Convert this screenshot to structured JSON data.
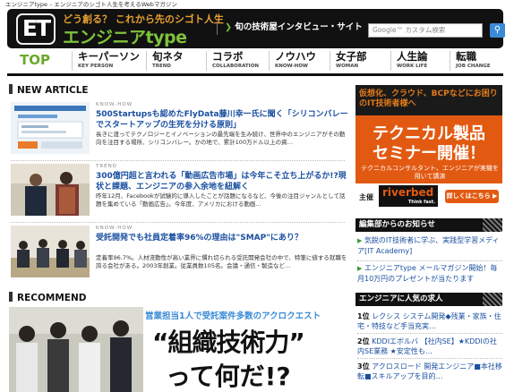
{
  "topline": "エンジニアtype – エンジニアのシゴト人生を考えるWebマガジン",
  "header": {
    "logo_mark": "ET",
    "slogan": "どう創る？ これから先のシゴト人生",
    "site_name": "エンジニアtype",
    "banner_text": "旬の技術屋インタビュー・サイト",
    "search_placeholder": "Google™ カスタム検索",
    "search_icon": "search-icon"
  },
  "nav": {
    "top_label": "TOP",
    "items": [
      {
        "jp": "キーパーソン",
        "en": "KEY PERSON"
      },
      {
        "jp": "旬ネタ",
        "en": "TREND"
      },
      {
        "jp": "コラボ",
        "en": "COLLABORATION"
      },
      {
        "jp": "ノウハウ",
        "en": "KNOW-HOW"
      },
      {
        "jp": "女子部",
        "en": "WOMAN"
      },
      {
        "jp": "人生論",
        "en": "WORK LIFE"
      },
      {
        "jp": "転職",
        "en": "JOB CHANGE"
      }
    ]
  },
  "new_article": {
    "heading": "NEW ARTICLE",
    "articles": [
      {
        "category": "KNOW-HOW",
        "title": "500Startupsも認めたFlyData藤川幸一氏に聞く「シリコンバレーでスタートアップの生死を分ける原則」",
        "summary": "長きに渡ってテクノロジーとイノベーションの最先端を生み続け、世界中のエンジニアがその動向を注目する場所、シリコンバレー。かの地で、累計100万ドル以上の資…"
      },
      {
        "category": "TREND",
        "title": "300億円超と言われる「動画広告市場」は今年こそ立ち上がるか!?現状と課題、エンジニアの参入余地を紐解く",
        "summary": "昨年12月、Facebookが試験的に導入したことが話題になるなど、今後の注目ジャンルとして話題を集めている「動画広告」。今年度、アメリカにおける動画…"
      },
      {
        "category": "KNOW-HOW",
        "title": "受託開発でも社員定着率96%の理由は\"SMAP\"にあり？",
        "summary": "定着率96.7%。人材流動性が高い業界に慣れ切られる受託開発会社の中で、特筆に値する就職を誇る会社がある。2003年創業。従業員数105名。会議・通信・製造など…"
      }
    ]
  },
  "recommend": {
    "heading": "RECOMMEND",
    "caption": "営業担当1人で受託案件多数のアクロクエスト",
    "big_line1": "“組織技術力”",
    "big_line2": "って何だ!?"
  },
  "ad": {
    "top_text": "仮想化、クラウド、BCPなどにお困りのIT技術者様へ",
    "title1": "テクニカル製品",
    "title2": "セミナー開催！",
    "sub": "テクニカルコンサルタント、エンジニアが実機を用いて講演",
    "host_label": "主催",
    "host_logo": "riverbed",
    "host_tagline": "Think fast.",
    "more_button": "詳しくはこちら ▶"
  },
  "news": {
    "heading": "編集部からのお知らせ",
    "items": [
      "気鋭のIT技術者に学ぶ、実践型学習メディア[IT Academy]",
      "エンジニアtype メールマガジン開始！毎月10万円のプレゼントが当たります"
    ]
  },
  "jobs": {
    "heading": "エンジニアに人気の求人",
    "items": [
      {
        "rank": "1位",
        "text": "レクシス システム開発◆残業・家族・住宅・特技など手当充実…"
      },
      {
        "rank": "2位",
        "text": "KDDIエボルバ 【社内SE】★KDDIの社内SE業務 ★安定性も…"
      },
      {
        "rank": "3位",
        "text": "アクロスロード 開発エンジニア■本社移転■スキルアップを目的…"
      }
    ]
  }
}
